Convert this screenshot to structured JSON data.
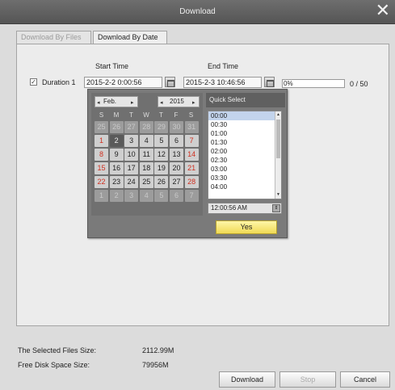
{
  "window": {
    "title": "Download",
    "close_icon": "close-icon"
  },
  "tabs": [
    {
      "label": "Download By Files",
      "active": false
    },
    {
      "label": "Download By Date",
      "active": true
    }
  ],
  "form": {
    "start_time_label": "Start Time",
    "end_time_label": "End Time",
    "duration_label": "Duration 1",
    "duration_checked": true,
    "start_value": "2015-2-2 0:00:56",
    "end_value": "2015-2-3 10:46:56",
    "progress_text": "0%",
    "progress_fraction": 0,
    "count": "0 / 50"
  },
  "calendar": {
    "month": "Feb.",
    "year": "2015",
    "weekdays": [
      "S",
      "M",
      "T",
      "W",
      "T",
      "F",
      "S"
    ],
    "rows": [
      [
        "25",
        "26",
        "27",
        "28",
        "29",
        "30",
        "31"
      ],
      [
        "1",
        "2",
        "3",
        "4",
        "5",
        "6",
        "7"
      ],
      [
        "8",
        "9",
        "10",
        "11",
        "12",
        "13",
        "14"
      ],
      [
        "15",
        "16",
        "17",
        "18",
        "19",
        "20",
        "21"
      ],
      [
        "22",
        "23",
        "24",
        "25",
        "26",
        "27",
        "28"
      ],
      [
        "1",
        "2",
        "3",
        "4",
        "5",
        "6",
        "7"
      ]
    ],
    "selected_day": "2"
  },
  "quick_select": {
    "header": "Quick Select",
    "items": [
      "00:00",
      "00:30",
      "01:00",
      "01:30",
      "02:00",
      "02:30",
      "03:00",
      "03:30",
      "04:00"
    ],
    "selected": "00:00",
    "time_value": "12:00:56 AM",
    "yes_label": "Yes"
  },
  "status": {
    "selected_size_label": "The Selected Files Size:",
    "selected_size_value": "2112.99M",
    "free_space_label": "Free Disk Space Size:",
    "free_space_value": "79956M"
  },
  "buttons": {
    "download": "Download",
    "stop": "Stop",
    "cancel": "Cancel"
  },
  "colors": {
    "accent_yes": "#f0da55",
    "weekend_red": "#d03020"
  }
}
